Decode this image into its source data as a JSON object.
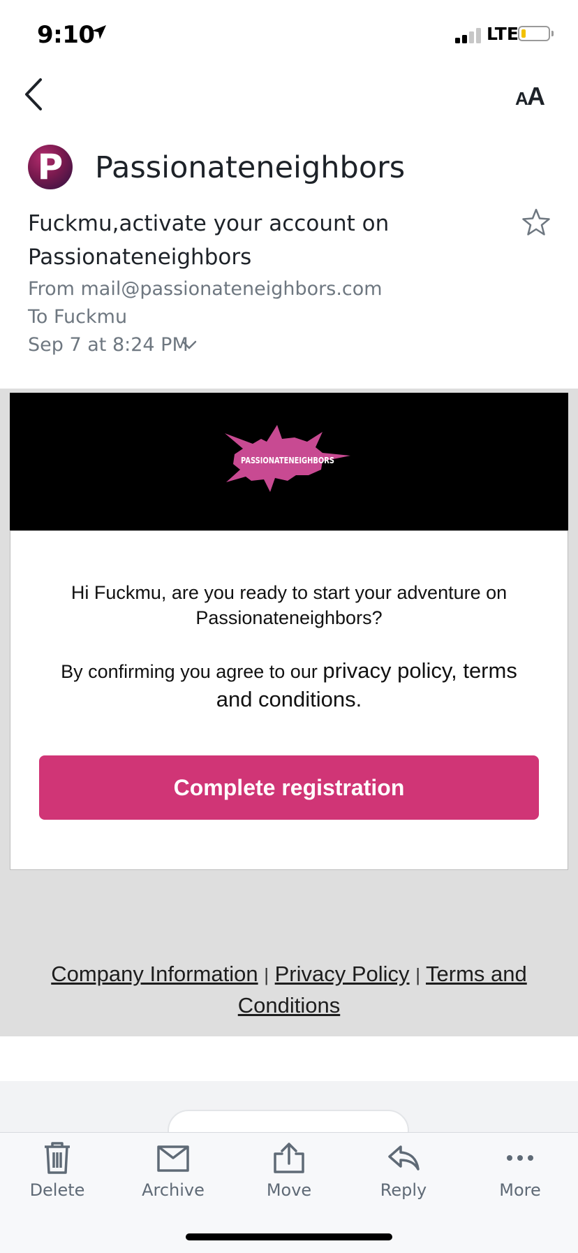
{
  "status_bar": {
    "time": "9:10",
    "network": "LTE",
    "battery_color": "#f2c100"
  },
  "header": {
    "back_icon": "chevron-left-icon",
    "text_size_icon": "text-size-icon"
  },
  "email": {
    "sender_initial": "P",
    "sender_name": "Passionateneighbors",
    "subject": "Fuckmu,activate your account on Passionateneighbors",
    "from": "From mail@passionateneighbors.com",
    "to": "To Fuckmu",
    "date": "Sep 7 at 8:24 PM"
  },
  "body": {
    "logo_text": "PASSIONATENEIGHBORS",
    "greeting": "Hi Fuckmu, are you ready to start your adventure on Passionateneighbors?",
    "confirm_prefix": "By confirming you agree to our ",
    "confirm_link": "privacy policy, terms and conditions.",
    "cta_label": "Complete registration",
    "cta_color": "#d03576",
    "footer_links": [
      "Company Information",
      "Privacy Policy",
      "Terms and Conditions"
    ],
    "footer_separator": "|"
  },
  "toolbar": {
    "items": [
      {
        "label": "Delete",
        "icon": "trash-icon"
      },
      {
        "label": "Archive",
        "icon": "archive-icon"
      },
      {
        "label": "Move",
        "icon": "move-icon"
      },
      {
        "label": "Reply",
        "icon": "reply-icon"
      },
      {
        "label": "More",
        "icon": "more-icon"
      }
    ]
  }
}
